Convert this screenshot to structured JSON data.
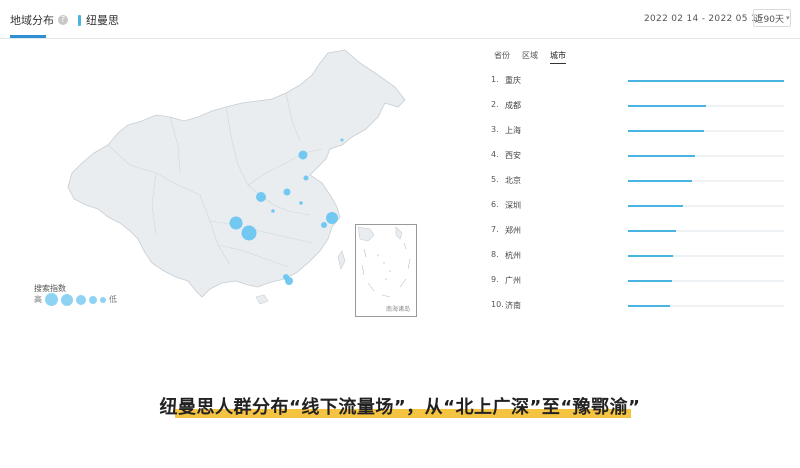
{
  "header": {
    "tab_label": "地域分布",
    "help_icon": "?",
    "series_name": "纽曼思",
    "series_color": "#4ab4e0",
    "date_range": "2022 02 14 - 2022 05 15",
    "days_label": "近90天"
  },
  "map": {
    "scale_title": "搜索指数",
    "scale_high": "高",
    "scale_low": "低",
    "inset_label": "南海诸岛"
  },
  "ranking": {
    "tabs": [
      "省份",
      "区域",
      "城市"
    ],
    "active_tab": "城市",
    "items": [
      {
        "rank": "1.",
        "name": "重庆",
        "value": 1.0
      },
      {
        "rank": "2.",
        "name": "成都",
        "value": 0.5
      },
      {
        "rank": "3.",
        "name": "上海",
        "value": 0.49
      },
      {
        "rank": "4.",
        "name": "西安",
        "value": 0.43
      },
      {
        "rank": "5.",
        "name": "北京",
        "value": 0.41
      },
      {
        "rank": "6.",
        "name": "深圳",
        "value": 0.35
      },
      {
        "rank": "7.",
        "name": "郑州",
        "value": 0.31
      },
      {
        "rank": "8.",
        "name": "杭州",
        "value": 0.29
      },
      {
        "rank": "9.",
        "name": "广州",
        "value": 0.28
      },
      {
        "rank": "10.",
        "name": "济南",
        "value": 0.27
      }
    ]
  },
  "caption": {
    "text": "纽曼思人群分布“线下流量场”，从“北上广深”至“豫鄂渝”",
    "highlight_color": "#f5c342"
  }
}
